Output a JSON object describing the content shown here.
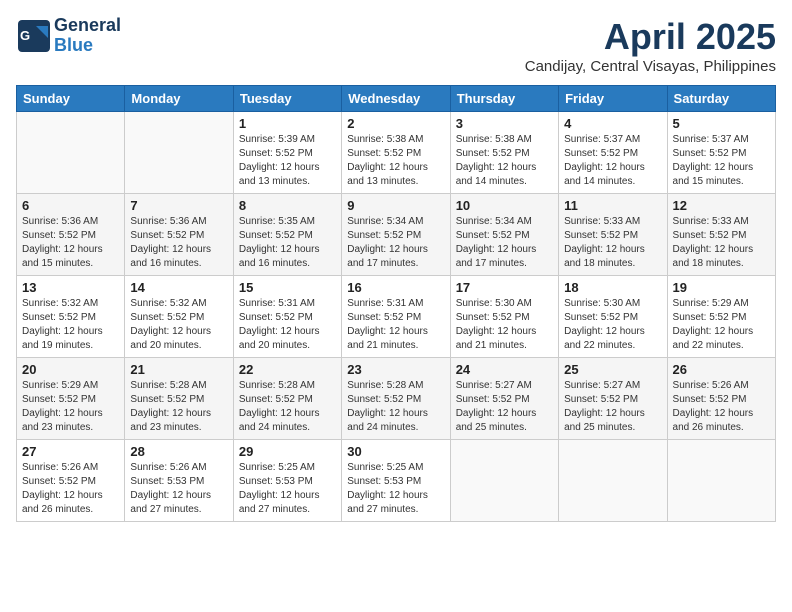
{
  "logo": {
    "general": "General",
    "blue": "Blue",
    "tagline": ""
  },
  "title": "April 2025",
  "subtitle": "Candijay, Central Visayas, Philippines",
  "headers": [
    "Sunday",
    "Monday",
    "Tuesday",
    "Wednesday",
    "Thursday",
    "Friday",
    "Saturday"
  ],
  "weeks": [
    [
      {
        "day": "",
        "info": ""
      },
      {
        "day": "",
        "info": ""
      },
      {
        "day": "1",
        "info": "Sunrise: 5:39 AM\nSunset: 5:52 PM\nDaylight: 12 hours and 13 minutes."
      },
      {
        "day": "2",
        "info": "Sunrise: 5:38 AM\nSunset: 5:52 PM\nDaylight: 12 hours and 13 minutes."
      },
      {
        "day": "3",
        "info": "Sunrise: 5:38 AM\nSunset: 5:52 PM\nDaylight: 12 hours and 14 minutes."
      },
      {
        "day": "4",
        "info": "Sunrise: 5:37 AM\nSunset: 5:52 PM\nDaylight: 12 hours and 14 minutes."
      },
      {
        "day": "5",
        "info": "Sunrise: 5:37 AM\nSunset: 5:52 PM\nDaylight: 12 hours and 15 minutes."
      }
    ],
    [
      {
        "day": "6",
        "info": "Sunrise: 5:36 AM\nSunset: 5:52 PM\nDaylight: 12 hours and 15 minutes."
      },
      {
        "day": "7",
        "info": "Sunrise: 5:36 AM\nSunset: 5:52 PM\nDaylight: 12 hours and 16 minutes."
      },
      {
        "day": "8",
        "info": "Sunrise: 5:35 AM\nSunset: 5:52 PM\nDaylight: 12 hours and 16 minutes."
      },
      {
        "day": "9",
        "info": "Sunrise: 5:34 AM\nSunset: 5:52 PM\nDaylight: 12 hours and 17 minutes."
      },
      {
        "day": "10",
        "info": "Sunrise: 5:34 AM\nSunset: 5:52 PM\nDaylight: 12 hours and 17 minutes."
      },
      {
        "day": "11",
        "info": "Sunrise: 5:33 AM\nSunset: 5:52 PM\nDaylight: 12 hours and 18 minutes."
      },
      {
        "day": "12",
        "info": "Sunrise: 5:33 AM\nSunset: 5:52 PM\nDaylight: 12 hours and 18 minutes."
      }
    ],
    [
      {
        "day": "13",
        "info": "Sunrise: 5:32 AM\nSunset: 5:52 PM\nDaylight: 12 hours and 19 minutes."
      },
      {
        "day": "14",
        "info": "Sunrise: 5:32 AM\nSunset: 5:52 PM\nDaylight: 12 hours and 20 minutes."
      },
      {
        "day": "15",
        "info": "Sunrise: 5:31 AM\nSunset: 5:52 PM\nDaylight: 12 hours and 20 minutes."
      },
      {
        "day": "16",
        "info": "Sunrise: 5:31 AM\nSunset: 5:52 PM\nDaylight: 12 hours and 21 minutes."
      },
      {
        "day": "17",
        "info": "Sunrise: 5:30 AM\nSunset: 5:52 PM\nDaylight: 12 hours and 21 minutes."
      },
      {
        "day": "18",
        "info": "Sunrise: 5:30 AM\nSunset: 5:52 PM\nDaylight: 12 hours and 22 minutes."
      },
      {
        "day": "19",
        "info": "Sunrise: 5:29 AM\nSunset: 5:52 PM\nDaylight: 12 hours and 22 minutes."
      }
    ],
    [
      {
        "day": "20",
        "info": "Sunrise: 5:29 AM\nSunset: 5:52 PM\nDaylight: 12 hours and 23 minutes."
      },
      {
        "day": "21",
        "info": "Sunrise: 5:28 AM\nSunset: 5:52 PM\nDaylight: 12 hours and 23 minutes."
      },
      {
        "day": "22",
        "info": "Sunrise: 5:28 AM\nSunset: 5:52 PM\nDaylight: 12 hours and 24 minutes."
      },
      {
        "day": "23",
        "info": "Sunrise: 5:28 AM\nSunset: 5:52 PM\nDaylight: 12 hours and 24 minutes."
      },
      {
        "day": "24",
        "info": "Sunrise: 5:27 AM\nSunset: 5:52 PM\nDaylight: 12 hours and 25 minutes."
      },
      {
        "day": "25",
        "info": "Sunrise: 5:27 AM\nSunset: 5:52 PM\nDaylight: 12 hours and 25 minutes."
      },
      {
        "day": "26",
        "info": "Sunrise: 5:26 AM\nSunset: 5:52 PM\nDaylight: 12 hours and 26 minutes."
      }
    ],
    [
      {
        "day": "27",
        "info": "Sunrise: 5:26 AM\nSunset: 5:52 PM\nDaylight: 12 hours and 26 minutes."
      },
      {
        "day": "28",
        "info": "Sunrise: 5:26 AM\nSunset: 5:53 PM\nDaylight: 12 hours and 27 minutes."
      },
      {
        "day": "29",
        "info": "Sunrise: 5:25 AM\nSunset: 5:53 PM\nDaylight: 12 hours and 27 minutes."
      },
      {
        "day": "30",
        "info": "Sunrise: 5:25 AM\nSunset: 5:53 PM\nDaylight: 12 hours and 27 minutes."
      },
      {
        "day": "",
        "info": ""
      },
      {
        "day": "",
        "info": ""
      },
      {
        "day": "",
        "info": ""
      }
    ]
  ]
}
